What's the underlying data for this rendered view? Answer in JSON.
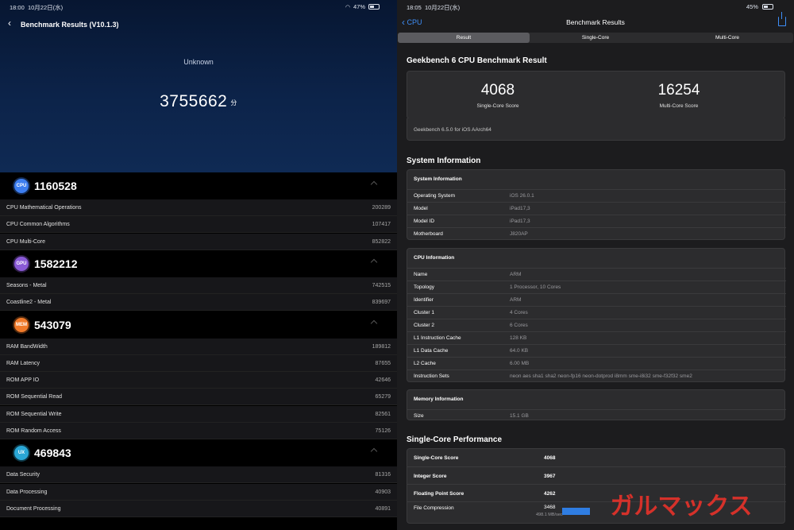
{
  "left": {
    "status": {
      "time": "18:00",
      "date": "10月22日(水)",
      "battery": "47%"
    },
    "header": {
      "title": "Benchmark Results (V10.1.3)"
    },
    "device": "Unknown",
    "total": {
      "score": "3755662",
      "unit": "分"
    },
    "sections": [
      {
        "icon": "CPU",
        "color": "#3d7ef0",
        "score": "1160528",
        "items": [
          {
            "label": "CPU Mathematical Operations",
            "value": "200289"
          },
          {
            "label": "CPU Common Algorithms",
            "value": "107417"
          },
          {
            "label": "CPU Multi-Core",
            "value": "852822"
          }
        ]
      },
      {
        "icon": "GPU",
        "color": "#8a5ad6",
        "score": "1582212",
        "items": [
          {
            "label": "Seasons - Metal",
            "value": "742515"
          },
          {
            "label": "Coastline2 - Metal",
            "value": "839697"
          }
        ]
      },
      {
        "icon": "MEM",
        "color": "#f07a2a",
        "score": "543079",
        "items": [
          {
            "label": "RAM BandWidth",
            "value": "189812"
          },
          {
            "label": "RAM Latency",
            "value": "87655"
          },
          {
            "label": "ROM APP IO",
            "value": "42646"
          },
          {
            "label": "ROM Sequential Read",
            "value": "65279"
          },
          {
            "label": "ROM Sequential Write",
            "value": "82561"
          },
          {
            "label": "ROM Random Access",
            "value": "75126"
          }
        ]
      },
      {
        "icon": "UX",
        "color": "#2aa7d6",
        "score": "469843",
        "items": [
          {
            "label": "Data Security",
            "value": "81316"
          },
          {
            "label": "Data Processing",
            "value": "40903"
          },
          {
            "label": "Document Processing",
            "value": "40891"
          }
        ]
      }
    ]
  },
  "right": {
    "status": {
      "time": "18:05",
      "date": "10月22日(水)",
      "battery": "45%"
    },
    "nav": {
      "back": "CPU",
      "title": "Benchmark Results"
    },
    "tabs": [
      "Result",
      "Single-Core",
      "Multi-Core"
    ],
    "result_heading": "Geekbench 6 CPU Benchmark Result",
    "single_score": "4068",
    "single_label": "Single-Core Score",
    "multi_score": "16254",
    "multi_label": "Multi-Core Score",
    "version": "Geekbench 6.5.0 for iOS AArch64",
    "sysinfo_heading": "System Information",
    "system": {
      "title": "System Information",
      "rows": [
        {
          "label": "Operating System",
          "value": "iOS 26.0.1"
        },
        {
          "label": "Model",
          "value": "iPad17,3"
        },
        {
          "label": "Model ID",
          "value": "iPad17,3"
        },
        {
          "label": "Motherboard",
          "value": "J820AP"
        }
      ]
    },
    "cpu": {
      "title": "CPU Information",
      "rows": [
        {
          "label": "Name",
          "value": "ARM"
        },
        {
          "label": "Topology",
          "value": "1 Processor, 10 Cores"
        },
        {
          "label": "Identifier",
          "value": "ARM"
        },
        {
          "label": "Cluster 1",
          "value": "4 Cores"
        },
        {
          "label": "Cluster 2",
          "value": "6 Cores"
        },
        {
          "label": "L1 Instruction Cache",
          "value": "128 KB"
        },
        {
          "label": "L1 Data Cache",
          "value": "64.0 KB"
        },
        {
          "label": "L2 Cache",
          "value": "6.00 MB"
        },
        {
          "label": "Instruction Sets",
          "value": "neon aes sha1 sha2 neon-fp16 neon-dotprod i8mm sme-i8i32 sme-f32f32 sme2"
        }
      ]
    },
    "memory": {
      "title": "Memory Information",
      "rows": [
        {
          "label": "Size",
          "value": "15.1 GB"
        }
      ]
    },
    "perf_heading": "Single-Core Performance",
    "perf": [
      {
        "label": "Single-Core Score",
        "value": "4068"
      },
      {
        "label": "Integer Score",
        "value": "3967"
      },
      {
        "label": "Floating Point Score",
        "value": "4262"
      },
      {
        "label": "File Compression",
        "value": "3468",
        "sub": "498.1 MB/sec",
        "bar": 0.35
      }
    ]
  },
  "watermark": "ガルマックス",
  "colors": {
    "accent": "#3e8ef7",
    "watermark": "#e8322a"
  }
}
